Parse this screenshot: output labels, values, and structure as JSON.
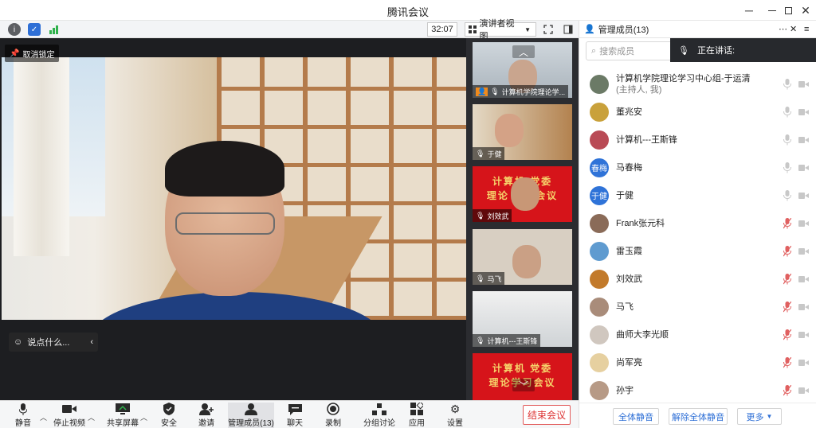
{
  "window": {
    "title": "腾讯会议"
  },
  "subbar": {
    "timer": "32:07",
    "view_label": "演讲者视图"
  },
  "stage": {
    "unpin_label": "取消锁定",
    "chat_placeholder": "说点什么..."
  },
  "thumbnails": [
    {
      "label": "计算机学院理论学..."
    },
    {
      "label": "于健"
    },
    {
      "label": "刘效武",
      "banner": "计算机  党委",
      "banner2": "理论  学习会议"
    },
    {
      "label": "马飞"
    },
    {
      "label": "计算机---王斯锋"
    },
    {
      "label": "",
      "banner": "计算机  党委",
      "banner2": "理论学习会议"
    }
  ],
  "panel": {
    "title": "管理成员(13)",
    "search_placeholder": "搜索成员",
    "speaking_label": "正在讲话:",
    "members": [
      {
        "name": "计算机学院理论学习中心组-于运清",
        "sub": "(主持人, 我)",
        "avatar": "",
        "avatar_color": "#6b7a66",
        "muted": false
      },
      {
        "name": "董兆安",
        "avatar": "",
        "avatar_color": "#c9a13b",
        "muted": false
      },
      {
        "name": "计算机---王斯锋",
        "avatar": "",
        "avatar_color": "#b94a55",
        "muted": false
      },
      {
        "name": "马春梅",
        "avatar": "春梅",
        "avatar_color": "#2f73d8",
        "muted": false
      },
      {
        "name": "于健",
        "avatar": "于健",
        "avatar_color": "#2f73d8",
        "muted": false
      },
      {
        "name": "Frank张元科",
        "avatar": "",
        "avatar_color": "#8a6b58",
        "muted": true
      },
      {
        "name": "雷玉霞",
        "avatar": "",
        "avatar_color": "#5f9bd0",
        "muted": true
      },
      {
        "name": "刘效武",
        "avatar": "",
        "avatar_color": "#c27a2b",
        "muted": true
      },
      {
        "name": "马飞",
        "avatar": "",
        "avatar_color": "#a98c7a",
        "muted": true
      },
      {
        "name": "曲师大李光顺",
        "avatar": "",
        "avatar_color": "#d0c7bf",
        "muted": true
      },
      {
        "name": "尚军亮",
        "avatar": "",
        "avatar_color": "#e6d0a0",
        "muted": true
      },
      {
        "name": "孙宇",
        "avatar": "",
        "avatar_color": "#b79a86",
        "muted": true
      }
    ],
    "mute_all": "全体静音",
    "unmute_all": "解除全体静音",
    "more": "更多"
  },
  "toolbar": {
    "mute": "静音",
    "stop_video": "停止视频",
    "share": "共享屏幕",
    "security": "安全",
    "invite": "邀请",
    "members": "管理成员(13)",
    "chat": "聊天",
    "record": "录制",
    "breakout": "分组讨论",
    "apps": "应用",
    "settings": "设置",
    "end": "结束会议"
  },
  "colors": {
    "accent": "#2e6fd6",
    "danger": "#d33333",
    "muted_red": "#e06060"
  }
}
